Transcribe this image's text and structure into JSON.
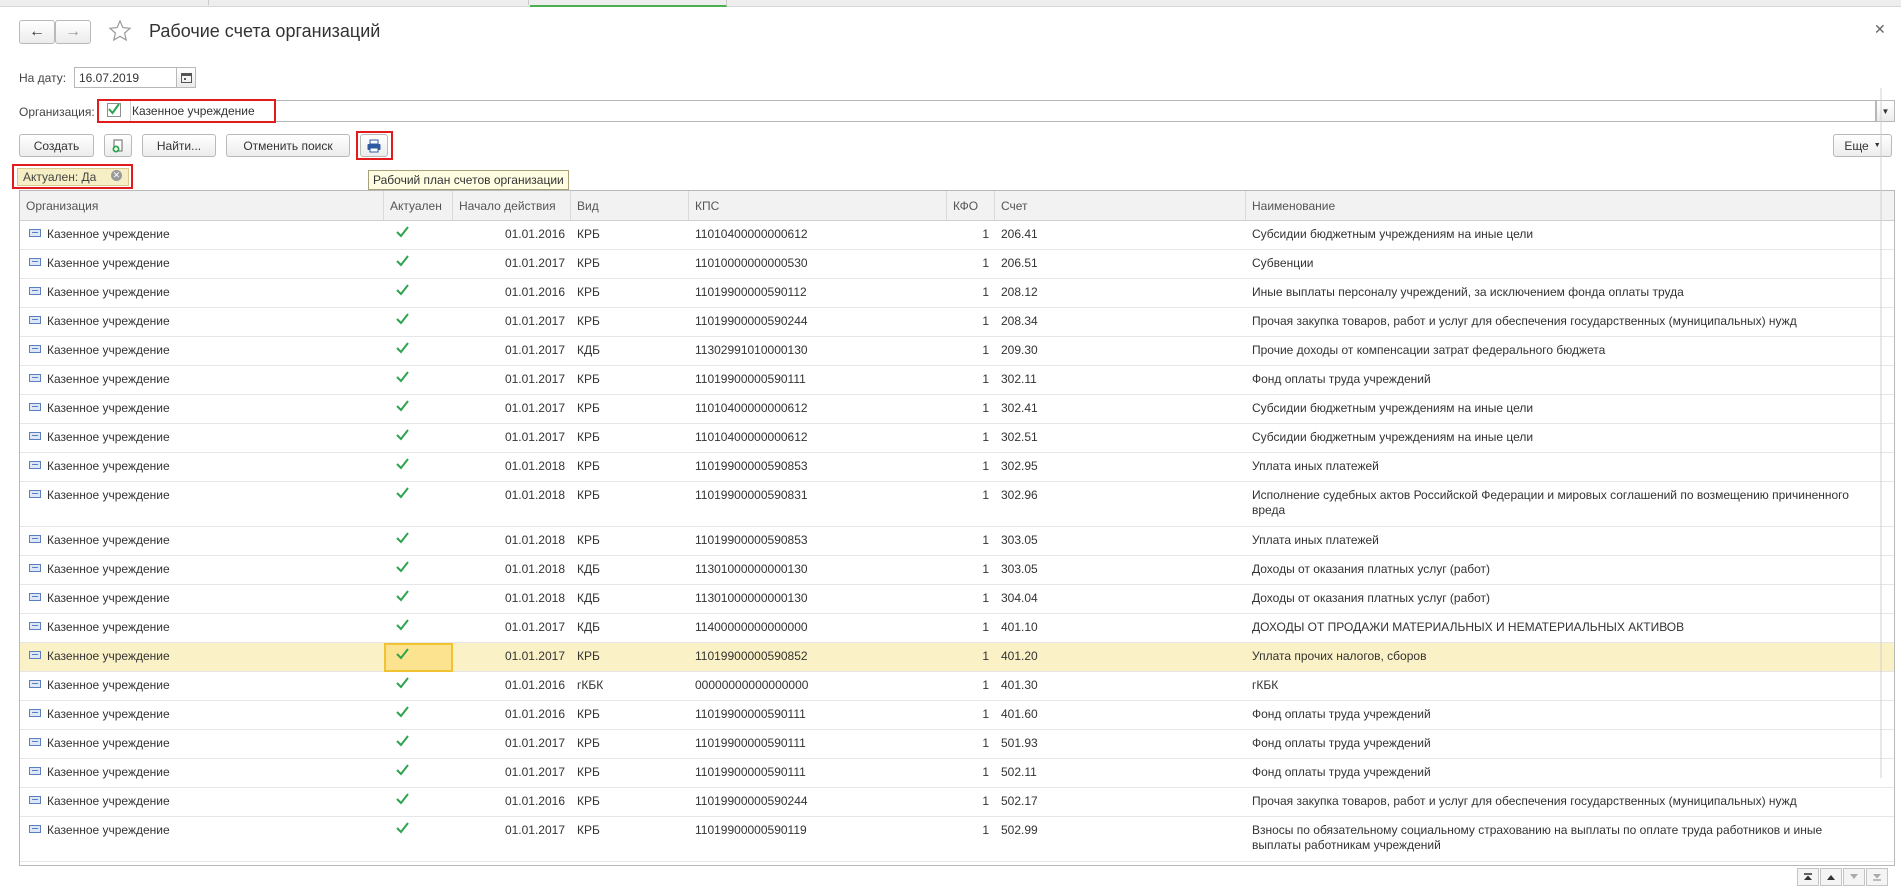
{
  "window": {
    "title": "Рабочие счета организаций"
  },
  "toolbar": {
    "back_label": "←",
    "forward_label": "→"
  },
  "date_filter": {
    "label": "На дату:",
    "value": "16.07.2019"
  },
  "organization_filter": {
    "label": "Организация:",
    "checked": true,
    "value": "Казенное учреждение"
  },
  "actions": {
    "create_label": "Создать",
    "find_label": "Найти...",
    "cancel_search_label": "Отменить поиск",
    "more_label": "Еще"
  },
  "active_filter": {
    "label": "Актуален: Да"
  },
  "tooltip": {
    "text": "Рабочий план счетов организации"
  },
  "colors": {
    "highlight_red": "#e21c1c",
    "check_green": "#2ea44f",
    "selected_row": "#fbf1c6",
    "accent_green": "#4caf50"
  },
  "table": {
    "columns": [
      "Организация",
      "Актуален",
      "Начало действия",
      "Вид",
      "КПС",
      "КФО",
      "Счет",
      "Наименование"
    ],
    "rows": [
      {
        "org": "Казенное учреждение",
        "actual": true,
        "start": "01.01.2016",
        "kind": "КРБ",
        "kps": "11010400000000612",
        "kfo": "1",
        "account": "206.41",
        "name": "Субсидии бюджетным учреждениям на иные цели"
      },
      {
        "org": "Казенное учреждение",
        "actual": true,
        "start": "01.01.2017",
        "kind": "КРБ",
        "kps": "11010000000000530",
        "kfo": "1",
        "account": "206.51",
        "name": "Субвенции"
      },
      {
        "org": "Казенное учреждение",
        "actual": true,
        "start": "01.01.2016",
        "kind": "КРБ",
        "kps": "11019900000590112",
        "kfo": "1",
        "account": "208.12",
        "name": "Иные выплаты персоналу учреждений, за исключением фонда оплаты труда"
      },
      {
        "org": "Казенное учреждение",
        "actual": true,
        "start": "01.01.2017",
        "kind": "КРБ",
        "kps": "11019900000590244",
        "kfo": "1",
        "account": "208.34",
        "name": "Прочая закупка товаров, работ и услуг для обеспечения государственных (муниципальных) нужд"
      },
      {
        "org": "Казенное учреждение",
        "actual": true,
        "start": "01.01.2017",
        "kind": "КДБ",
        "kps": "11302991010000130",
        "kfo": "1",
        "account": "209.30",
        "name": "Прочие доходы от компенсации затрат федерального бюджета"
      },
      {
        "org": "Казенное учреждение",
        "actual": true,
        "start": "01.01.2017",
        "kind": "КРБ",
        "kps": "11019900000590111",
        "kfo": "1",
        "account": "302.11",
        "name": "Фонд оплаты труда учреждений"
      },
      {
        "org": "Казенное учреждение",
        "actual": true,
        "start": "01.01.2017",
        "kind": "КРБ",
        "kps": "11010400000000612",
        "kfo": "1",
        "account": "302.41",
        "name": "Субсидии бюджетным учреждениям на иные цели"
      },
      {
        "org": "Казенное учреждение",
        "actual": true,
        "start": "01.01.2017",
        "kind": "КРБ",
        "kps": "11010400000000612",
        "kfo": "1",
        "account": "302.51",
        "name": "Субсидии бюджетным учреждениям на иные цели"
      },
      {
        "org": "Казенное учреждение",
        "actual": true,
        "start": "01.01.2018",
        "kind": "КРБ",
        "kps": "11019900000590853",
        "kfo": "1",
        "account": "302.95",
        "name": "Уплата иных платежей"
      },
      {
        "org": "Казенное учреждение",
        "actual": true,
        "start": "01.01.2018",
        "kind": "КРБ",
        "kps": "11019900000590831",
        "kfo": "1",
        "account": "302.96",
        "name": "Исполнение судебных актов Российской Федерации и мировых соглашений по возмещению причиненного вреда"
      },
      {
        "org": "Казенное учреждение",
        "actual": true,
        "start": "01.01.2018",
        "kind": "КРБ",
        "kps": "11019900000590853",
        "kfo": "1",
        "account": "303.05",
        "name": "Уплата иных платежей"
      },
      {
        "org": "Казенное учреждение",
        "actual": true,
        "start": "01.01.2018",
        "kind": "КДБ",
        "kps": "11301000000000130",
        "kfo": "1",
        "account": "303.05",
        "name": "Доходы от оказания платных услуг (работ)"
      },
      {
        "org": "Казенное учреждение",
        "actual": true,
        "start": "01.01.2018",
        "kind": "КДБ",
        "kps": "11301000000000130",
        "kfo": "1",
        "account": "304.04",
        "name": "Доходы от оказания платных услуг (работ)"
      },
      {
        "org": "Казенное учреждение",
        "actual": true,
        "start": "01.01.2017",
        "kind": "КДБ",
        "kps": "11400000000000000",
        "kfo": "1",
        "account": "401.10",
        "name": "ДОХОДЫ ОТ ПРОДАЖИ МАТЕРИАЛЬНЫХ И НЕМАТЕРИАЛЬНЫХ АКТИВОВ"
      },
      {
        "org": "Казенное учреждение",
        "actual": true,
        "start": "01.01.2017",
        "kind": "КРБ",
        "kps": "11019900000590852",
        "kfo": "1",
        "account": "401.20",
        "name": "Уплата прочих налогов, сборов",
        "selected": true
      },
      {
        "org": "Казенное учреждение",
        "actual": true,
        "start": "01.01.2016",
        "kind": "гКБК",
        "kps": "00000000000000000",
        "kfo": "1",
        "account": "401.30",
        "name": "гКБК"
      },
      {
        "org": "Казенное учреждение",
        "actual": true,
        "start": "01.01.2016",
        "kind": "КРБ",
        "kps": "11019900000590111",
        "kfo": "1",
        "account": "401.60",
        "name": "Фонд оплаты труда учреждений"
      },
      {
        "org": "Казенное учреждение",
        "actual": true,
        "start": "01.01.2017",
        "kind": "КРБ",
        "kps": "11019900000590111",
        "kfo": "1",
        "account": "501.93",
        "name": "Фонд оплаты труда учреждений"
      },
      {
        "org": "Казенное учреждение",
        "actual": true,
        "start": "01.01.2017",
        "kind": "КРБ",
        "kps": "11019900000590111",
        "kfo": "1",
        "account": "502.11",
        "name": "Фонд оплаты труда учреждений"
      },
      {
        "org": "Казенное учреждение",
        "actual": true,
        "start": "01.01.2016",
        "kind": "КРБ",
        "kps": "11019900000590244",
        "kfo": "1",
        "account": "502.17",
        "name": "Прочая закупка товаров, работ и услуг для обеспечения государственных (муниципальных) нужд"
      },
      {
        "org": "Казенное учреждение",
        "actual": true,
        "start": "01.01.2017",
        "kind": "КРБ",
        "kps": "11019900000590119",
        "kfo": "1",
        "account": "502.99",
        "name": "Взносы по обязательному социальному страхованию на выплаты по оплате труда работников и иные выплаты работникам учреждений"
      }
    ]
  }
}
